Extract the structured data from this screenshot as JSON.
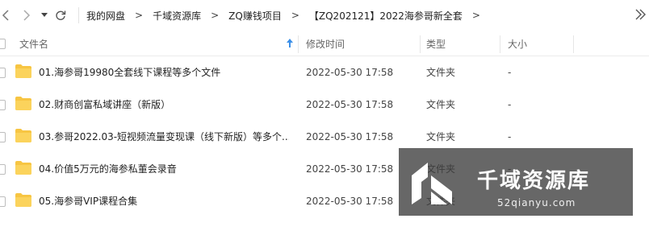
{
  "breadcrumb": [
    "我的网盘",
    "千域资源库",
    "ZQ赚钱项目",
    "【ZQ202121】2022海参哥新全套"
  ],
  "breadcrumb_separator": ">",
  "columns": {
    "name": "文件名",
    "modified": "修改时间",
    "type": "类型",
    "size": "大小"
  },
  "files": [
    {
      "name": "01.海参哥19980全套线下课程等多个文件",
      "modified": "2022-05-30 17:58",
      "type": "文件夹",
      "size": "-"
    },
    {
      "name": "02.财商创富私域讲座（新版）",
      "modified": "2022-05-30 17:58",
      "type": "文件夹",
      "size": "-"
    },
    {
      "name": "03.参哥2022.03-短视频流量变现课（线下新版）等多个...",
      "modified": "2022-05-30 17:58",
      "type": "文件夹",
      "size": "-"
    },
    {
      "name": "04.价值5万元的海参私董会录音",
      "modified": "2022-05-30 17:58",
      "type": "文件夹",
      "size": "-"
    },
    {
      "name": "05.海参哥VIP课程合集",
      "modified": "2022-05-30 17:58",
      "type": "文件夹",
      "size": "-"
    }
  ],
  "watermark": {
    "title": "千域资源库",
    "url": "52qianyu.com"
  },
  "colors": {
    "folder": "#f7c543",
    "sort_arrow": "#3b8fe8",
    "watermark_bg": "#3c3c3c"
  },
  "icons": [
    "back-arrow-icon",
    "forward-arrow-icon",
    "dropdown-icon",
    "refresh-icon",
    "sort-ascending-icon",
    "folder-icon"
  ]
}
